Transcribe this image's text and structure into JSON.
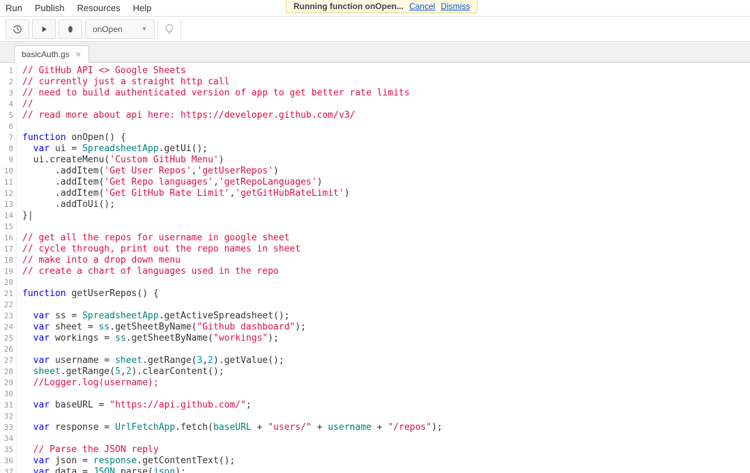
{
  "menubar": {
    "run": "Run",
    "publish": "Publish",
    "resources": "Resources",
    "help": "Help"
  },
  "notification": {
    "message": "Running function onOpen...",
    "cancel": "Cancel",
    "dismiss": "Dismiss"
  },
  "toolbar": {
    "function_selected": "onOpen"
  },
  "tabs": {
    "active": "basicAuth.gs"
  },
  "code": {
    "lines": [
      [
        {
          "t": "// GitHub API <> Google Sheets",
          "c": "c-cmt"
        }
      ],
      [
        {
          "t": "// currently just a straight http call",
          "c": "c-cmt"
        }
      ],
      [
        {
          "t": "// need to build authenticated version of app to get better rate limits",
          "c": "c-cmt"
        }
      ],
      [
        {
          "t": "//",
          "c": "c-cmt"
        }
      ],
      [
        {
          "t": "// read more about api here: https://developer.github.com/v3/",
          "c": "c-cmt"
        }
      ],
      [],
      [
        {
          "t": "function",
          "c": "c-kw"
        },
        {
          "t": " onOpen",
          "c": "c-plain"
        },
        {
          "t": "()",
          "c": "c-plain"
        },
        {
          "t": " {",
          "c": "c-plain"
        }
      ],
      [
        {
          "t": "  ",
          "c": "c-plain"
        },
        {
          "t": "var",
          "c": "c-kw"
        },
        {
          "t": " ui ",
          "c": "c-plain"
        },
        {
          "t": "=",
          "c": "c-plain"
        },
        {
          "t": " SpreadsheetApp",
          "c": "c-id"
        },
        {
          "t": ".",
          "c": "c-plain"
        },
        {
          "t": "getUi",
          "c": "c-plain"
        },
        {
          "t": "();",
          "c": "c-plain"
        }
      ],
      [
        {
          "t": "  ui",
          "c": "c-plain"
        },
        {
          "t": ".",
          "c": "c-plain"
        },
        {
          "t": "createMenu",
          "c": "c-plain"
        },
        {
          "t": "(",
          "c": "c-plain"
        },
        {
          "t": "'Custom GitHub Menu'",
          "c": "c-str"
        },
        {
          "t": ")",
          "c": "c-plain"
        }
      ],
      [
        {
          "t": "      .",
          "c": "c-plain"
        },
        {
          "t": "addItem",
          "c": "c-plain"
        },
        {
          "t": "(",
          "c": "c-plain"
        },
        {
          "t": "'Get User Repos'",
          "c": "c-str"
        },
        {
          "t": ",",
          "c": "c-plain"
        },
        {
          "t": "'getUserRepos'",
          "c": "c-str"
        },
        {
          "t": ")",
          "c": "c-plain"
        }
      ],
      [
        {
          "t": "      .",
          "c": "c-plain"
        },
        {
          "t": "addItem",
          "c": "c-plain"
        },
        {
          "t": "(",
          "c": "c-plain"
        },
        {
          "t": "'Get Repo languages'",
          "c": "c-str"
        },
        {
          "t": ",",
          "c": "c-plain"
        },
        {
          "t": "'getRepoLanguages'",
          "c": "c-str"
        },
        {
          "t": ")",
          "c": "c-plain"
        }
      ],
      [
        {
          "t": "      .",
          "c": "c-plain"
        },
        {
          "t": "addItem",
          "c": "c-plain"
        },
        {
          "t": "(",
          "c": "c-plain"
        },
        {
          "t": "'Get GitHub Rate Limit'",
          "c": "c-str"
        },
        {
          "t": ",",
          "c": "c-plain"
        },
        {
          "t": "'getGitHubRateLimit'",
          "c": "c-str"
        },
        {
          "t": ")",
          "c": "c-plain"
        }
      ],
      [
        {
          "t": "      .",
          "c": "c-plain"
        },
        {
          "t": "addToUi",
          "c": "c-plain"
        },
        {
          "t": "();",
          "c": "c-plain"
        }
      ],
      [
        {
          "t": "}|",
          "c": "c-plain"
        }
      ],
      [],
      [
        {
          "t": "// get all the repos for username in google sheet",
          "c": "c-cmt"
        }
      ],
      [
        {
          "t": "// cycle through, print out the repo names in sheet",
          "c": "c-cmt"
        }
      ],
      [
        {
          "t": "// make into a drop down menu",
          "c": "c-cmt"
        }
      ],
      [
        {
          "t": "// create a chart of languages used in the repo",
          "c": "c-cmt"
        }
      ],
      [],
      [
        {
          "t": "function",
          "c": "c-kw"
        },
        {
          "t": " getUserRepos",
          "c": "c-plain"
        },
        {
          "t": "()",
          "c": "c-plain"
        },
        {
          "t": " {",
          "c": "c-plain"
        }
      ],
      [],
      [
        {
          "t": "  ",
          "c": "c-plain"
        },
        {
          "t": "var",
          "c": "c-kw"
        },
        {
          "t": " ss ",
          "c": "c-plain"
        },
        {
          "t": "=",
          "c": "c-plain"
        },
        {
          "t": " SpreadsheetApp",
          "c": "c-id"
        },
        {
          "t": ".",
          "c": "c-plain"
        },
        {
          "t": "getActiveSpreadsheet",
          "c": "c-plain"
        },
        {
          "t": "();",
          "c": "c-plain"
        }
      ],
      [
        {
          "t": "  ",
          "c": "c-plain"
        },
        {
          "t": "var",
          "c": "c-kw"
        },
        {
          "t": " sheet ",
          "c": "c-plain"
        },
        {
          "t": "=",
          "c": "c-plain"
        },
        {
          "t": " ss",
          "c": "c-id"
        },
        {
          "t": ".",
          "c": "c-plain"
        },
        {
          "t": "getSheetByName",
          "c": "c-plain"
        },
        {
          "t": "(",
          "c": "c-plain"
        },
        {
          "t": "\"Github dashboard\"",
          "c": "c-str"
        },
        {
          "t": ");",
          "c": "c-plain"
        }
      ],
      [
        {
          "t": "  ",
          "c": "c-plain"
        },
        {
          "t": "var",
          "c": "c-kw"
        },
        {
          "t": " workings ",
          "c": "c-plain"
        },
        {
          "t": "=",
          "c": "c-plain"
        },
        {
          "t": " ss",
          "c": "c-id"
        },
        {
          "t": ".",
          "c": "c-plain"
        },
        {
          "t": "getSheetByName",
          "c": "c-plain"
        },
        {
          "t": "(",
          "c": "c-plain"
        },
        {
          "t": "\"workings\"",
          "c": "c-str"
        },
        {
          "t": ");",
          "c": "c-plain"
        }
      ],
      [],
      [
        {
          "t": "  ",
          "c": "c-plain"
        },
        {
          "t": "var",
          "c": "c-kw"
        },
        {
          "t": " username ",
          "c": "c-plain"
        },
        {
          "t": "=",
          "c": "c-plain"
        },
        {
          "t": " sheet",
          "c": "c-id"
        },
        {
          "t": ".",
          "c": "c-plain"
        },
        {
          "t": "getRange",
          "c": "c-plain"
        },
        {
          "t": "(",
          "c": "c-plain"
        },
        {
          "t": "3",
          "c": "c-num"
        },
        {
          "t": ",",
          "c": "c-plain"
        },
        {
          "t": "2",
          "c": "c-num"
        },
        {
          "t": ").",
          "c": "c-plain"
        },
        {
          "t": "getValue",
          "c": "c-plain"
        },
        {
          "t": "();",
          "c": "c-plain"
        }
      ],
      [
        {
          "t": "  sheet",
          "c": "c-id"
        },
        {
          "t": ".",
          "c": "c-plain"
        },
        {
          "t": "getRange",
          "c": "c-plain"
        },
        {
          "t": "(",
          "c": "c-plain"
        },
        {
          "t": "5",
          "c": "c-num"
        },
        {
          "t": ",",
          "c": "c-plain"
        },
        {
          "t": "2",
          "c": "c-num"
        },
        {
          "t": ").",
          "c": "c-plain"
        },
        {
          "t": "clearContent",
          "c": "c-plain"
        },
        {
          "t": "();",
          "c": "c-plain"
        }
      ],
      [
        {
          "t": "  ",
          "c": "c-plain"
        },
        {
          "t": "//Logger.log(username);",
          "c": "c-cmt"
        }
      ],
      [],
      [
        {
          "t": "  ",
          "c": "c-plain"
        },
        {
          "t": "var",
          "c": "c-kw"
        },
        {
          "t": " baseURL ",
          "c": "c-plain"
        },
        {
          "t": "=",
          "c": "c-plain"
        },
        {
          "t": " ",
          "c": "c-plain"
        },
        {
          "t": "\"https://api.github.com/\"",
          "c": "c-str"
        },
        {
          "t": ";",
          "c": "c-plain"
        }
      ],
      [],
      [
        {
          "t": "  ",
          "c": "c-plain"
        },
        {
          "t": "var",
          "c": "c-kw"
        },
        {
          "t": " response ",
          "c": "c-plain"
        },
        {
          "t": "=",
          "c": "c-plain"
        },
        {
          "t": " UrlFetchApp",
          "c": "c-id"
        },
        {
          "t": ".",
          "c": "c-plain"
        },
        {
          "t": "fetch",
          "c": "c-plain"
        },
        {
          "t": "(",
          "c": "c-plain"
        },
        {
          "t": "baseURL",
          "c": "c-id"
        },
        {
          "t": " + ",
          "c": "c-plain"
        },
        {
          "t": "\"users/\"",
          "c": "c-str"
        },
        {
          "t": " + ",
          "c": "c-plain"
        },
        {
          "t": "username",
          "c": "c-id"
        },
        {
          "t": " + ",
          "c": "c-plain"
        },
        {
          "t": "\"/repos\"",
          "c": "c-str"
        },
        {
          "t": ");",
          "c": "c-plain"
        }
      ],
      [],
      [
        {
          "t": "  ",
          "c": "c-plain"
        },
        {
          "t": "// Parse the JSON reply",
          "c": "c-cmt"
        }
      ],
      [
        {
          "t": "  ",
          "c": "c-plain"
        },
        {
          "t": "var",
          "c": "c-kw"
        },
        {
          "t": " json ",
          "c": "c-plain"
        },
        {
          "t": "=",
          "c": "c-plain"
        },
        {
          "t": " response",
          "c": "c-id"
        },
        {
          "t": ".",
          "c": "c-plain"
        },
        {
          "t": "getContentText",
          "c": "c-plain"
        },
        {
          "t": "();",
          "c": "c-plain"
        }
      ],
      [
        {
          "t": "  ",
          "c": "c-plain"
        },
        {
          "t": "var",
          "c": "c-kw"
        },
        {
          "t": " data ",
          "c": "c-plain"
        },
        {
          "t": "=",
          "c": "c-plain"
        },
        {
          "t": " JSON",
          "c": "c-id"
        },
        {
          "t": ".",
          "c": "c-plain"
        },
        {
          "t": "parse",
          "c": "c-plain"
        },
        {
          "t": "(",
          "c": "c-plain"
        },
        {
          "t": "json",
          "c": "c-id"
        },
        {
          "t": ");",
          "c": "c-plain"
        }
      ]
    ]
  }
}
